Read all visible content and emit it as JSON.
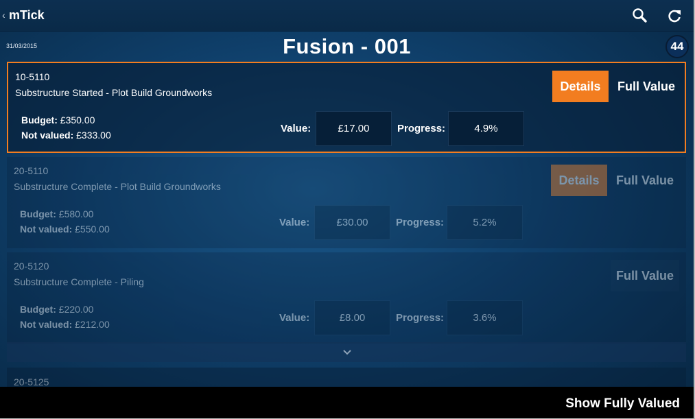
{
  "app": {
    "title": "mTick",
    "back_icon": "chevron-left-icon",
    "actions": [
      {
        "name": "search-icon"
      },
      {
        "name": "refresh-icon"
      }
    ]
  },
  "header": {
    "date": "31/03/2015",
    "title": "Fusion - 001",
    "count": "44"
  },
  "labels": {
    "budget": "Budget:",
    "not_valued": "Not valued:",
    "value": "Value:",
    "progress": "Progress:",
    "details": "Details",
    "full_value": "Full Value"
  },
  "items": [
    {
      "code": "10-5110",
      "description": "Substructure Started - Plot Build Groundworks",
      "budget": "£350.00",
      "not_valued": "£333.00",
      "value": "£17.00",
      "progress": "4.9%",
      "selected": true
    },
    {
      "code": "20-5110",
      "description": "Substructure Complete - Plot Build Groundworks",
      "budget": "£580.00",
      "not_valued": "£550.00",
      "value": "£30.00",
      "progress": "5.2%",
      "selected": false
    },
    {
      "code": "20-5120",
      "description": "Substructure Complete - Piling",
      "budget": "£220.00",
      "not_valued": "£212.00",
      "value": "£8.00",
      "progress": "3.6%",
      "selected": false
    },
    {
      "code": "20-5125"
    }
  ],
  "footer": {
    "show_fully_valued": "Show Fully Valued"
  },
  "colors": {
    "accent": "#f27d20",
    "background": "#0f3f6a",
    "input_bg": "#061f38"
  }
}
